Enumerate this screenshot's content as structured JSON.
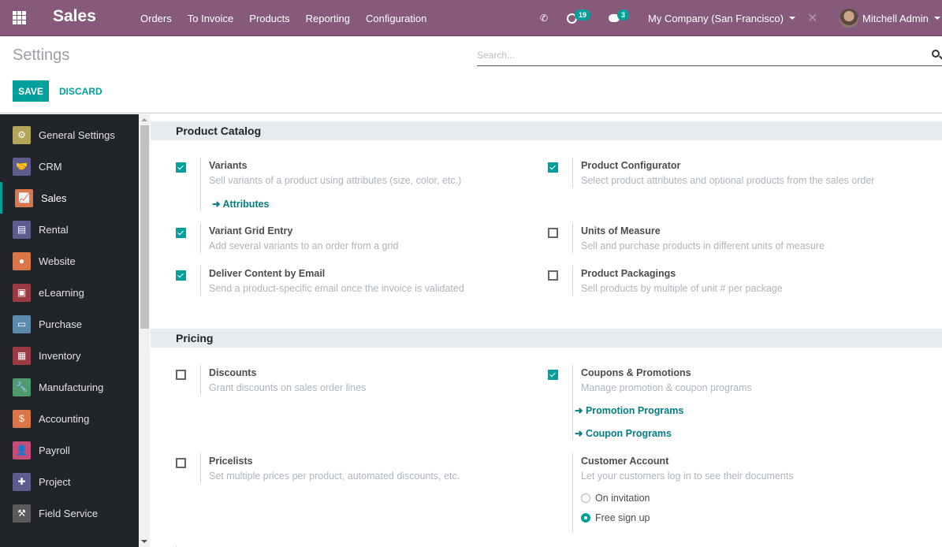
{
  "navbar": {
    "brand": "Sales",
    "menu": [
      "Orders",
      "To Invoice",
      "Products",
      "Reporting",
      "Configuration"
    ],
    "activity_count": "19",
    "messages_count": "3",
    "company": "My Company (San Francisco)",
    "user": "Mitchell Admin",
    "icons": [
      "apps-grid-icon",
      "phone-icon",
      "clock-icon",
      "comments-icon",
      "debug-tools-icon"
    ]
  },
  "control_panel": {
    "title": "Settings",
    "search_placeholder": "Search...",
    "save_label": "SAVE",
    "discard_label": "DISCARD"
  },
  "sidebar": {
    "active": "Sales",
    "items": [
      {
        "label": "General Settings",
        "icon": "⚙",
        "color": "#b5a55a"
      },
      {
        "label": "CRM",
        "icon": "🤝",
        "color": "#5f5b8f"
      },
      {
        "label": "Sales",
        "icon": "📈",
        "color": "#d9764a"
      },
      {
        "label": "Rental",
        "icon": "▤",
        "color": "#5f5b8f"
      },
      {
        "label": "Website",
        "icon": "●",
        "color": "#d9764a"
      },
      {
        "label": "eLearning",
        "icon": "▣",
        "color": "#9a3a43"
      },
      {
        "label": "Purchase",
        "icon": "▭",
        "color": "#5b8aad"
      },
      {
        "label": "Inventory",
        "icon": "▦",
        "color": "#9a3a43"
      },
      {
        "label": "Manufacturing",
        "icon": "🔧",
        "color": "#4f9a6f"
      },
      {
        "label": "Accounting",
        "icon": "$",
        "color": "#d9764a"
      },
      {
        "label": "Payroll",
        "icon": "👤",
        "color": "#c44d78"
      },
      {
        "label": "Project",
        "icon": "✚",
        "color": "#5f5b8f"
      },
      {
        "label": "Field Service",
        "icon": "⚒",
        "color": "#5a5a5a"
      }
    ]
  },
  "sections": [
    {
      "title": "Product Catalog",
      "settings": [
        {
          "title": "Variants",
          "desc": "Sell variants of a product using attributes (size, color, etc.)",
          "checked": true,
          "links": [
            "Attributes"
          ]
        },
        {
          "title": "Product Configurator",
          "desc": "Select product attributes and optional products from the sales order",
          "checked": true
        },
        {
          "title": "Variant Grid Entry",
          "desc": "Add several variants to an order from a grid",
          "checked": true
        },
        {
          "title": "Units of Measure",
          "desc": "Sell and purchase products in different units of measure",
          "checked": false
        },
        {
          "title": "Deliver Content by Email",
          "desc": "Send a product-specific email once the invoice is validated",
          "checked": true
        },
        {
          "title": "Product Packagings",
          "desc": "Sell products by multiple of unit # per package",
          "checked": false
        }
      ]
    },
    {
      "title": "Pricing",
      "settings": [
        {
          "title": "Discounts",
          "desc": "Grant discounts on sales order lines",
          "checked": false
        },
        {
          "title": "Coupons & Promotions",
          "desc": "Manage promotion & coupon programs",
          "checked": true,
          "links": [
            "Promotion Programs",
            "Coupon Programs"
          ]
        },
        {
          "title": "Pricelists",
          "desc": "Set multiple prices per product, automated discounts, etc.",
          "checked": false
        },
        {
          "title": "Customer Account",
          "desc": "Let your customers log in to see their documents",
          "options": [
            "On invitation",
            "Free sign up"
          ],
          "selected": "Free sign up"
        }
      ]
    }
  ],
  "colors": {
    "navbar": "#875a7b",
    "accent": "#00a09d",
    "link": "#017e84",
    "sidebar": "#212529"
  }
}
